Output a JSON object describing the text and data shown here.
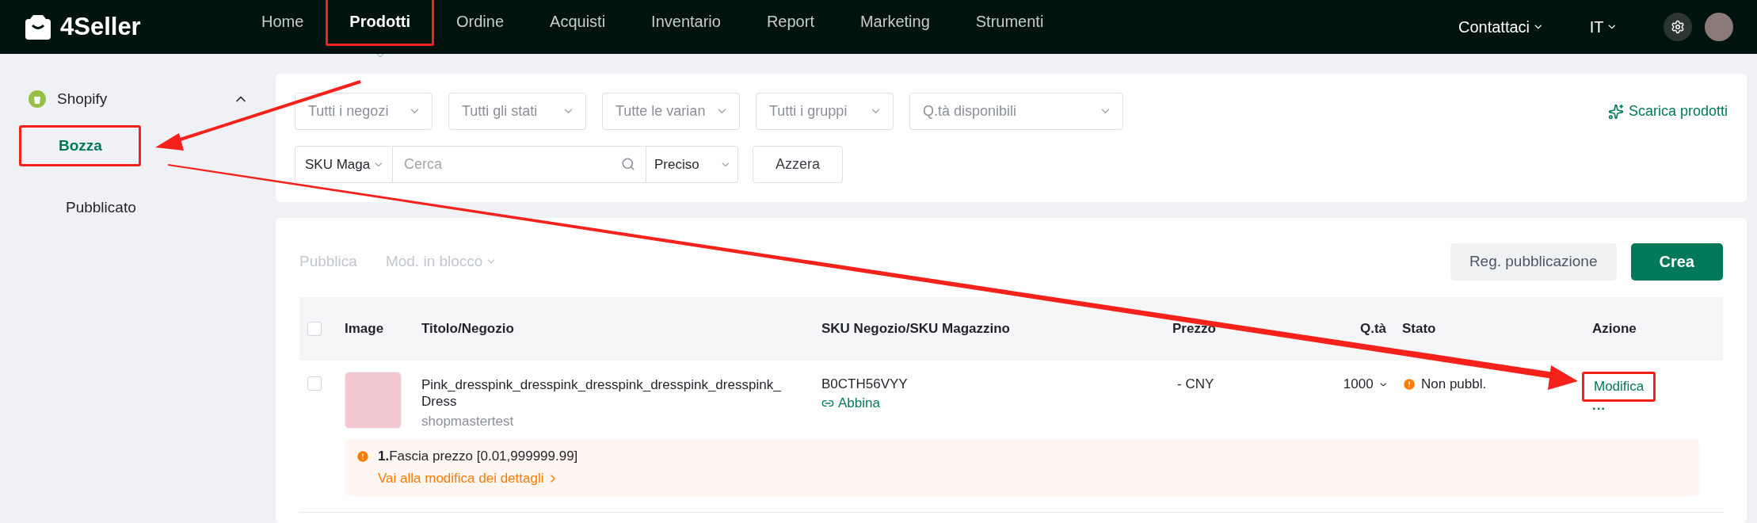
{
  "brand": {
    "name": "4Seller"
  },
  "nav": [
    {
      "label": "Home",
      "selected": false,
      "highlighted": false
    },
    {
      "label": "Prodotti",
      "selected": true,
      "highlighted": true
    },
    {
      "label": "Ordine",
      "selected": false,
      "highlighted": false
    },
    {
      "label": "Acquisti",
      "selected": false,
      "highlighted": false
    },
    {
      "label": "Inventario",
      "selected": false,
      "highlighted": false
    },
    {
      "label": "Report",
      "selected": false,
      "highlighted": false
    },
    {
      "label": "Marketing",
      "selected": false,
      "highlighted": false
    },
    {
      "label": "Strumenti",
      "selected": false,
      "highlighted": false
    }
  ],
  "header_right": {
    "contact": "Contattaci",
    "language": "IT"
  },
  "sidebar": {
    "group": {
      "label": "Shopify",
      "expanded": true,
      "items": [
        {
          "label": "Bozza",
          "selected": true,
          "highlighted": true
        },
        {
          "label": "Pubblicato",
          "selected": false,
          "highlighted": false
        }
      ]
    }
  },
  "filters": {
    "dropdowns": [
      "Tutti i negozi",
      "Tutti gli stati",
      "Tutte le varian",
      "Tutti i gruppi",
      "Q.tà disponibili"
    ],
    "download": "Scarica prodotti",
    "search": {
      "field": "SKU Maga",
      "placeholder": "Cerca",
      "mode": "Preciso"
    },
    "reset": "Azzera"
  },
  "toolbar": {
    "publish": {
      "label": "Pubblica",
      "disabled": true
    },
    "bulk_edit": {
      "label": "Mod. in blocco",
      "disabled": true
    },
    "log": "Reg. pubblicazione",
    "create": "Crea"
  },
  "table": {
    "select_all": {
      "checked": false
    },
    "columns": [
      "Image",
      "Titolo/Negozio",
      "SKU Negozio/SKU Magazzino",
      "Prezzo",
      "Q.tà",
      "Stato",
      "Azione"
    ],
    "rows": [
      {
        "checked": false,
        "title": "Pink_dresspink_dresspink_dresspink_dresspink_dresspink_Dress",
        "store": "shopmastertest",
        "sku": "B0CTH56VYY",
        "match": "Abbina",
        "price": "- CNY",
        "qty": "1000",
        "status": "Non pubbl.",
        "action": {
          "label": "Modifica",
          "highlighted": true
        },
        "more": "···",
        "warning": {
          "text": "**1.**Fascia prezzo [0.01,999999.99]",
          "link": "Vai alla modifica dei dettagli"
        }
      }
    ]
  }
}
